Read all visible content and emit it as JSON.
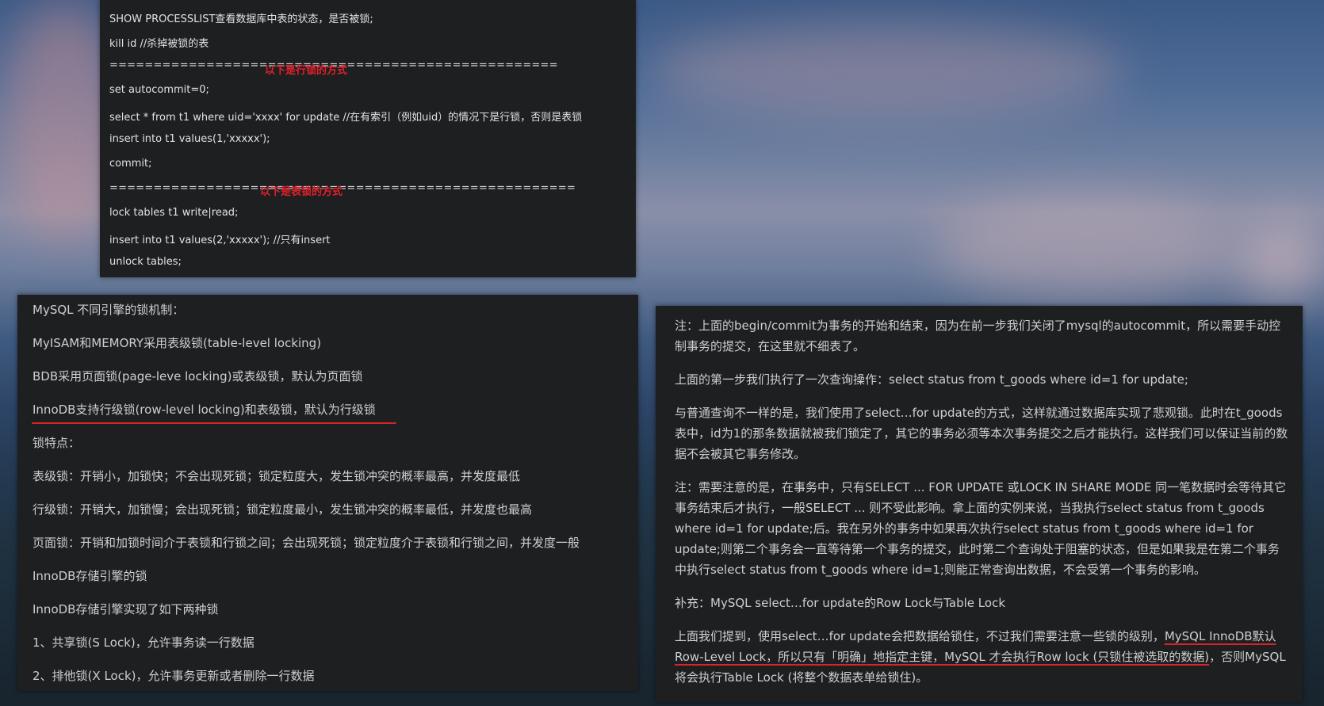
{
  "code_block": {
    "lines": [
      "SHOW PROCESSLIST查看数据库中表的状态，是否被锁;",
      "kill id   //杀掉被锁的表",
      "===================================================",
      "set autocommit=0;",
      "select * from t1  where uid='xxxx' for update    //在有索引（例如uid）的情况下是行锁，否则是表锁",
      "insert into t1 values(1,'xxxxx');",
      "commit;",
      "=====================================================",
      "lock tables t1 write|read;",
      "insert into t1 values(2,'xxxxx'); //只有insert",
      "unlock tables;"
    ],
    "row_lock_label": "以下是行锁的方式",
    "table_lock_label": "以下是表锁的方式"
  },
  "left_panel": {
    "lines": [
      "MySQL 不同引擎的锁机制：",
      "MyISAM和MEMORY采用表级锁(table-level locking)",
      "BDB采用页面锁(page-leve locking)或表级锁，默认为页面锁",
      "InnoDB支持行级锁(row-level locking)和表级锁，默认为行级锁",
      "锁特点：",
      "表级锁：开销小，加锁快；不会出现死锁；锁定粒度大，发生锁冲突的概率最高，并发度最低",
      "行级锁：开销大，加锁慢；会出现死锁；锁定粒度最小，发生锁冲突的概率最低，并发度也最高",
      "页面锁：开销和加锁时间介于表锁和行锁之间；会出现死锁；锁定粒度介于表锁和行锁之间，并发度一般",
      "InnoDB存储引擎的锁",
      "InnoDB存储引擎实现了如下两种锁",
      "1、共享锁(S Lock)，允许事务读一行数据",
      "2、排他锁(X Lock)，允许事务更新或者删除一行数据"
    ]
  },
  "right_panel": {
    "p1": "注：上面的begin/commit为事务的开始和结束，因为在前一步我们关闭了mysql的autocommit，所以需要手动控制事务的提交，在这里就不细表了。",
    "p2": "上面的第一步我们执行了一次查询操作：select status from t_goods where id=1 for update;",
    "p3": "与普通查询不一样的是，我们使用了select…for update的方式，这样就通过数据库实现了悲观锁。此时在t_goods表中，id为1的那条数据就被我们锁定了，其它的事务必须等本次事务提交之后才能执行。这样我们可以保证当前的数据不会被其它事务修改。",
    "p4": "注：需要注意的是，在事务中，只有SELECT ... FOR UPDATE 或LOCK IN SHARE MODE 同一笔数据时会等待其它事务结束后才执行，一般SELECT ... 则不受此影响。拿上面的实例来说，当我执行select status from t_goods where id=1 for update;后。我在另外的事务中如果再次执行select status from t_goods where id=1 for update;则第二个事务会一直等待第一个事务的提交，此时第二个查询处于阻塞的状态，但是如果我是在第二个事务中执行select status from t_goods where id=1;则能正常查询出数据，不会受第一个事务的影响。",
    "p5": "补充：MySQL select…for update的Row Lock与Table Lock",
    "p6_pre": "上面我们提到，使用select…for update会把数据给锁住，不过我们需要注意一些锁的级别，",
    "p6_mark": "MySQL InnoDB默认Row-Level Lock，所以只有「明确」地指定主键，MySQL 才会执行Row lock (只锁住被选取的数据)",
    "p6_post": "，否则MySQL 将会执行Table Lock (将整个数据表单给锁住)。"
  },
  "colors": {
    "accent_red": "#d8232a",
    "panel_bg": "#1e1f21"
  }
}
